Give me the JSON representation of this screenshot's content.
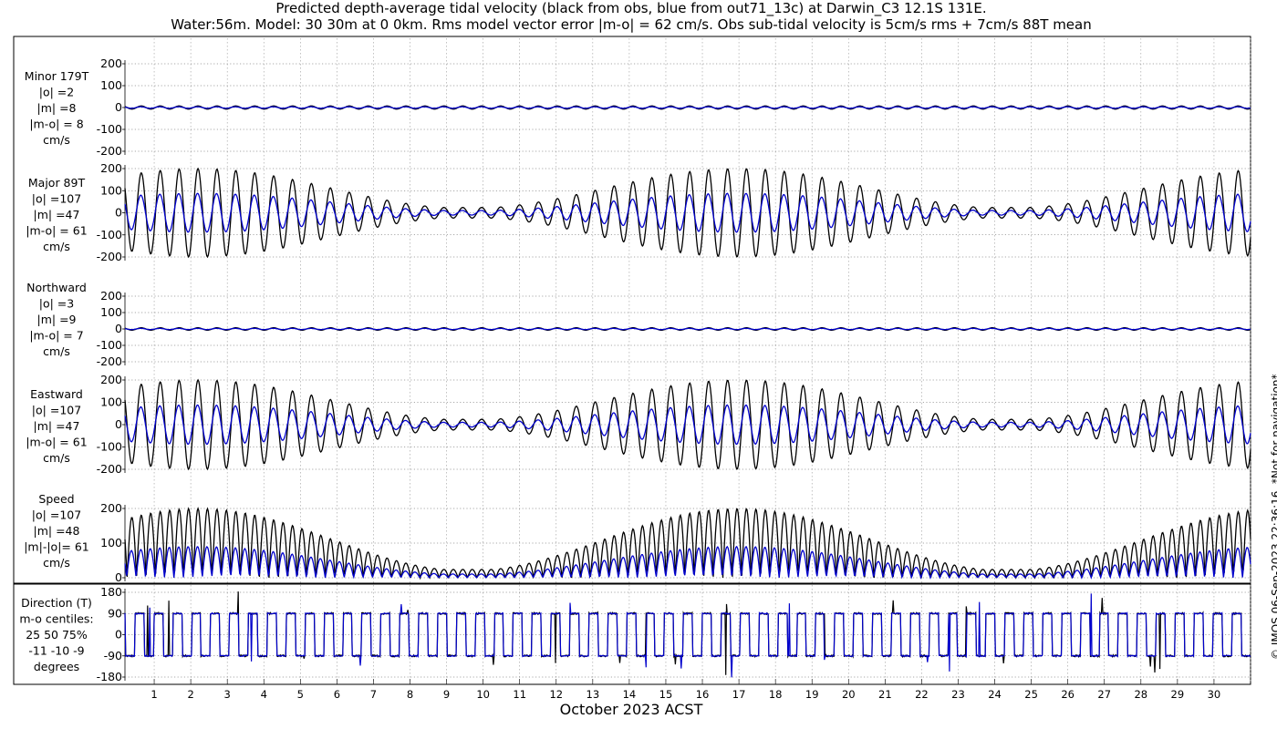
{
  "chart_data": {
    "type": "line",
    "title": "Predicted depth-average tidal velocity (black from obs, blue from out71_13c) at Darwin_C3 12.1S 131E.",
    "subtitle": "Water:56m. Model: 30 30m at 0 0km. Rms model vector error |m-o| = 62 cm/s. Obs sub-tidal velocity is 5cm/s rms + 7cm/s 88T mean",
    "xlabel": "October 2023 ACST",
    "x_ticks": [
      "1",
      "2",
      "3",
      "4",
      "5",
      "6",
      "7",
      "8",
      "9",
      "10",
      "11",
      "12",
      "13",
      "14",
      "15",
      "16",
      "17",
      "18",
      "19",
      "20",
      "21",
      "22",
      "23",
      "24",
      "25",
      "26",
      "27",
      "28",
      "29",
      "30"
    ],
    "xlim": [
      0.2,
      31.0
    ],
    "grid": true,
    "series_colors": {
      "obs": "#000000",
      "model": "#0000cc"
    },
    "panels": [
      {
        "id": "minor",
        "label_lines": [
          "Minor 179T",
          "|o| =2",
          "|m| =8",
          "|m-o| = 8",
          "cm/s"
        ],
        "ylim": [
          -200,
          200
        ],
        "yticks": [
          "200",
          "100",
          "0",
          "-100",
          "-200"
        ],
        "obs_amplitude": 8,
        "model_amplitude": 4
      },
      {
        "id": "major",
        "label_lines": [
          "Major 89T",
          "|o| =107",
          "|m| =47",
          "|m-o| = 61",
          "cm/s"
        ],
        "ylim": [
          -200,
          200
        ],
        "yticks": [
          "200",
          "100",
          "0",
          "-100",
          "-200"
        ],
        "obs_amplitude": 200,
        "model_amplitude": 88
      },
      {
        "id": "north",
        "label_lines": [
          "Northward",
          "|o| =3",
          "|m| =9",
          "|m-o| = 7",
          "cm/s"
        ],
        "ylim": [
          -200,
          200
        ],
        "yticks": [
          "200",
          "100",
          "0",
          "-100",
          "-200"
        ],
        "obs_amplitude": 8,
        "model_amplitude": 4
      },
      {
        "id": "east",
        "label_lines": [
          "Eastward",
          "|o| =107",
          "|m| =47",
          "|m-o| = 61",
          "cm/s"
        ],
        "ylim": [
          -200,
          200
        ],
        "yticks": [
          "200",
          "100",
          "0",
          "-100",
          "-200"
        ],
        "obs_amplitude": 200,
        "model_amplitude": 88
      },
      {
        "id": "speed",
        "label_lines": [
          "Speed",
          "|o| =107",
          "|m| =48",
          "|m|-|o|= 61",
          "cm/s"
        ],
        "ylim": [
          0,
          200
        ],
        "yticks": [
          "200",
          "100",
          "0"
        ],
        "obs_amplitude": 200,
        "model_amplitude": 90
      },
      {
        "id": "direction",
        "label_lines": [
          "Direction (T)",
          "m-o centiles:",
          "25  50  75%",
          "-11 -10  -9",
          "degrees"
        ],
        "ylim": [
          -180,
          180
        ],
        "yticks": [
          "180",
          "90",
          "0",
          "-90",
          "-180"
        ],
        "obs_levels": [
          90,
          -90
        ],
        "model_levels": [
          90,
          -90
        ]
      }
    ]
  },
  "credit": "© IMOS 06-Sep-2023 22:36:16. *Not for navigation*"
}
